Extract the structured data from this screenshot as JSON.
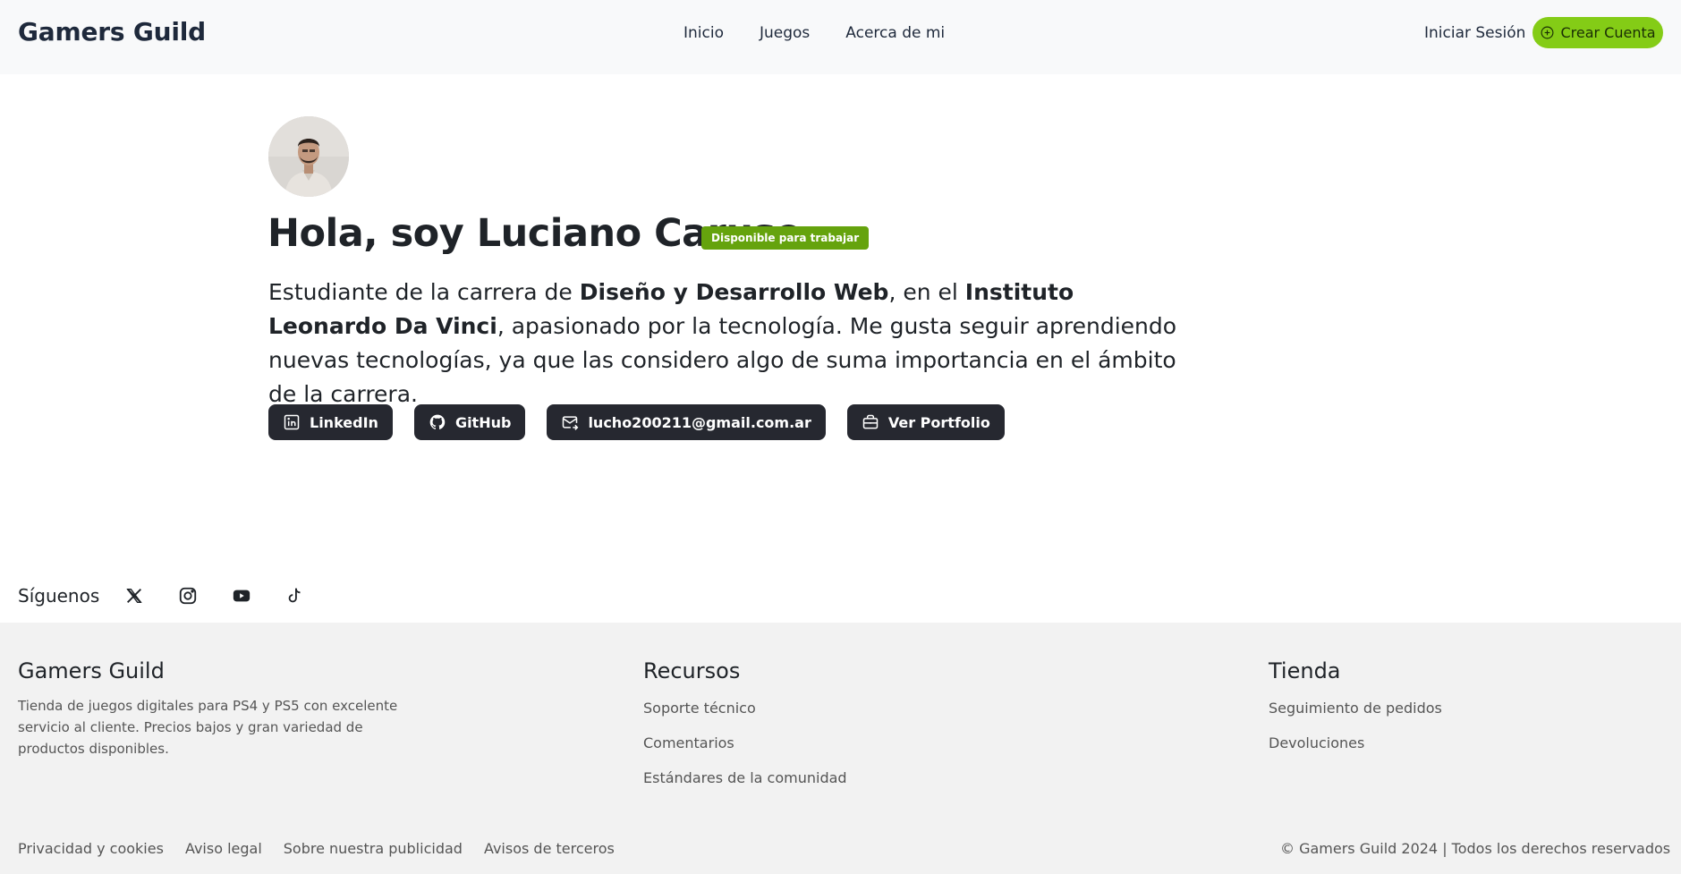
{
  "header": {
    "brand": "Gamers Guild",
    "nav": [
      "Inicio",
      "Juegos",
      "Acerca de mi"
    ],
    "login": "Iniciar Sesión",
    "create_account": "Crear Cuenta"
  },
  "profile": {
    "title": "Hola, soy Luciano Caruso",
    "badge": "Disponible para trabajar",
    "bio": {
      "p1": "Estudiante de la carrera de ",
      "b1": "Diseño y Desarrollo Web",
      "p2": ", en el ",
      "b2": "Instituto Leonardo Da Vinci",
      "p3": ", apasionado por la tecnología. Me gusta seguir aprendiendo nuevas tecnologías, ya que las considero algo de suma importancia en el ámbito de la carrera."
    },
    "buttons": [
      {
        "label": "LinkedIn",
        "icon": "linkedin-icon"
      },
      {
        "label": "GitHub",
        "icon": "github-icon"
      },
      {
        "label": "lucho200211@gmail.com.ar",
        "icon": "mail-icon"
      },
      {
        "label": "Ver Portfolio",
        "icon": "briefcase-icon"
      }
    ]
  },
  "follow": {
    "label": "Síguenos",
    "icons": [
      "x-icon",
      "instagram-icon",
      "youtube-icon",
      "tiktok-icon"
    ]
  },
  "footer": {
    "col1": {
      "title": "Gamers Guild",
      "desc": "Tienda de juegos digitales para PS4 y PS5 con excelente servicio al cliente. Precios bajos y gran variedad de productos disponibles."
    },
    "col2": {
      "title": "Recursos",
      "links": [
        "Soporte técnico",
        "Comentarios",
        "Estándares de la comunidad"
      ]
    },
    "col3": {
      "title": "Tienda",
      "links": [
        "Seguimiento de pedidos",
        "Devoluciones"
      ]
    },
    "legal": [
      "Privacidad y cookies",
      "Aviso legal",
      "Sobre nuestra publicidad",
      "Avisos de terceros"
    ],
    "copyright": "© Gamers Guild 2024 | Todos los derechos reservados"
  },
  "colors": {
    "accent": "#84cc16",
    "badge": "#65a30d",
    "dark_button": "#262830"
  }
}
